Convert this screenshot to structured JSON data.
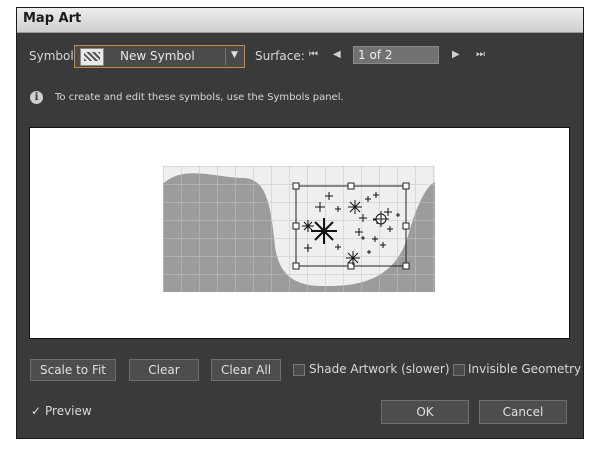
{
  "window": {
    "title": "Map Art"
  },
  "symbol": {
    "label": "Symbol:",
    "selected": "New Symbol",
    "dropdown_arrow": "▼"
  },
  "surface": {
    "label": "Surface:",
    "first_icon": "⏮",
    "prev_icon": "◀",
    "page_value": "1 of 2",
    "next_icon": "▶",
    "last_icon": "⏭"
  },
  "info": {
    "icon": "i",
    "text": "To create and edit these symbols, use the Symbols panel."
  },
  "buttons": {
    "scale_to_fit": "Scale to Fit",
    "clear": "Clear",
    "clear_all": "Clear All",
    "ok": "OK",
    "cancel": "Cancel"
  },
  "options": {
    "shade_artwork": {
      "label": "Shade Artwork (slower)",
      "checked": false
    },
    "invisible_geometry": {
      "label": "Invisible Geometry",
      "checked": false
    },
    "preview": {
      "label": "Preview",
      "checked": true,
      "mark": "✓"
    }
  },
  "colors": {
    "dialog_bg": "#3a3a3a",
    "accent_border": "#c98a3c",
    "surface_gray": "#9c9c9c",
    "surface_light": "#efefef"
  }
}
